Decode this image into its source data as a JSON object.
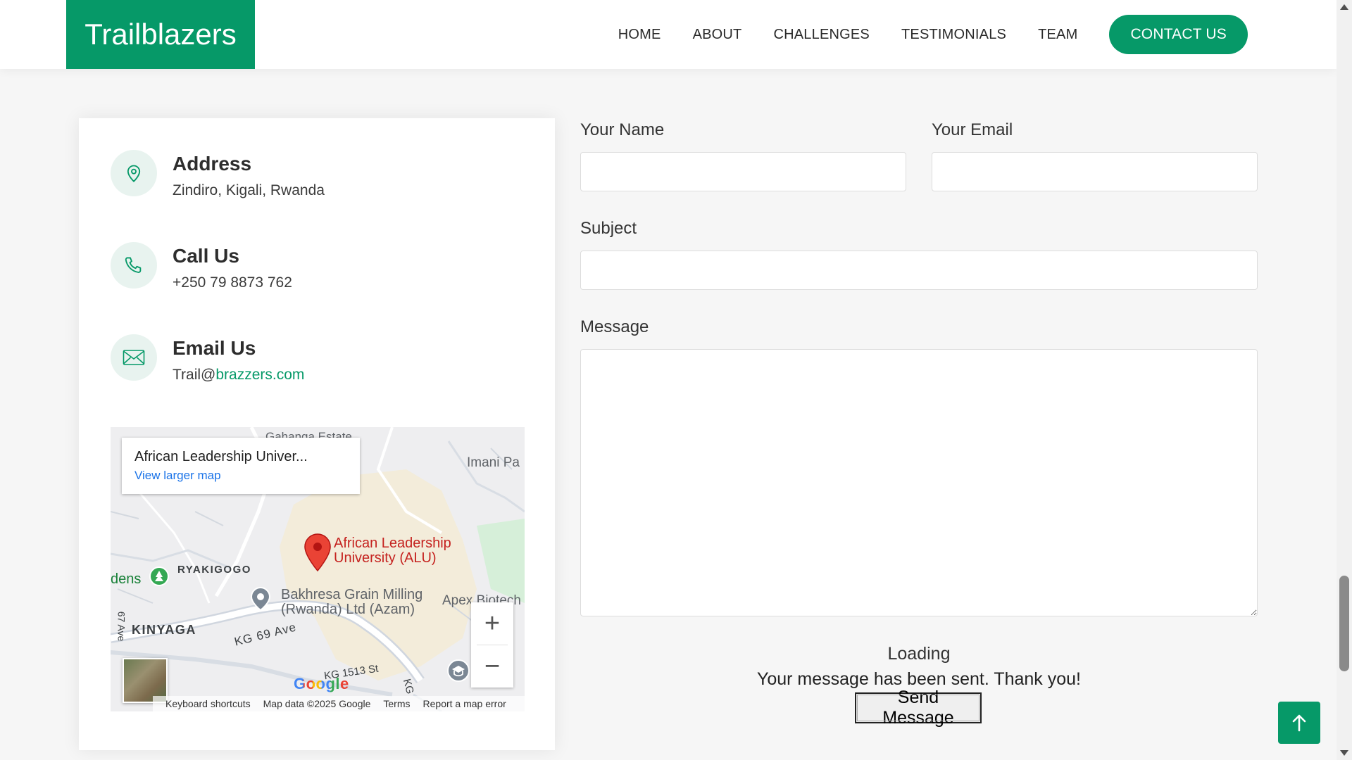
{
  "header": {
    "logo": "Trailblazers",
    "nav": [
      "HOME",
      "ABOUT",
      "CHALLENGES",
      "TESTIMONIALS",
      "TEAM"
    ],
    "cta": "CONTACT US"
  },
  "contact_info": {
    "address": {
      "title": "Address",
      "text": "Zindiro, Kigali, Rwanda",
      "icon": "map-pin-icon"
    },
    "call": {
      "title": "Call Us",
      "text": "+250 79 8873 762",
      "icon": "phone-icon"
    },
    "email": {
      "title": "Email Us",
      "prefix": "Trail@",
      "link": "brazzers.com",
      "icon": "envelope-icon"
    }
  },
  "map": {
    "callout_title": "African Leadership Univer...",
    "callout_link": "View larger map",
    "labels": {
      "estate": "Gahanga Estate",
      "imani": "Imani Pa",
      "alu_line1": "African Leadership",
      "alu_line2": "University (ALU)",
      "ryakigogo": "RYAKIGOGO",
      "gardens": "dens",
      "bakhresa_line1": "Bakhresa Grain Milling",
      "bakhresa_line2": "(Rwanda) Ltd (Azam)",
      "apex": "Apex Biotech",
      "kinyaga": "KINYAGA",
      "kg69": "KG 69 Ave",
      "kg1513": "KG 1513 St",
      "ave67": "67 Ave",
      "kg": "KG"
    },
    "google": "Google",
    "footer": [
      "Keyboard shortcuts",
      "Map data ©2025 Google",
      "Terms",
      "Report a map error"
    ],
    "zoom_in": "+",
    "zoom_out": "−"
  },
  "form": {
    "name_label": "Your Name",
    "email_label": "Your Email",
    "subject_label": "Subject",
    "message_label": "Message",
    "name_value": "",
    "email_value": "",
    "subject_value": "",
    "message_value": "",
    "loading": "Loading",
    "sent": "Your message has been sent. Thank you!",
    "submit": "Send Message"
  },
  "colors": {
    "brand": "#069968",
    "icon_bg": "#e8f3ef"
  }
}
